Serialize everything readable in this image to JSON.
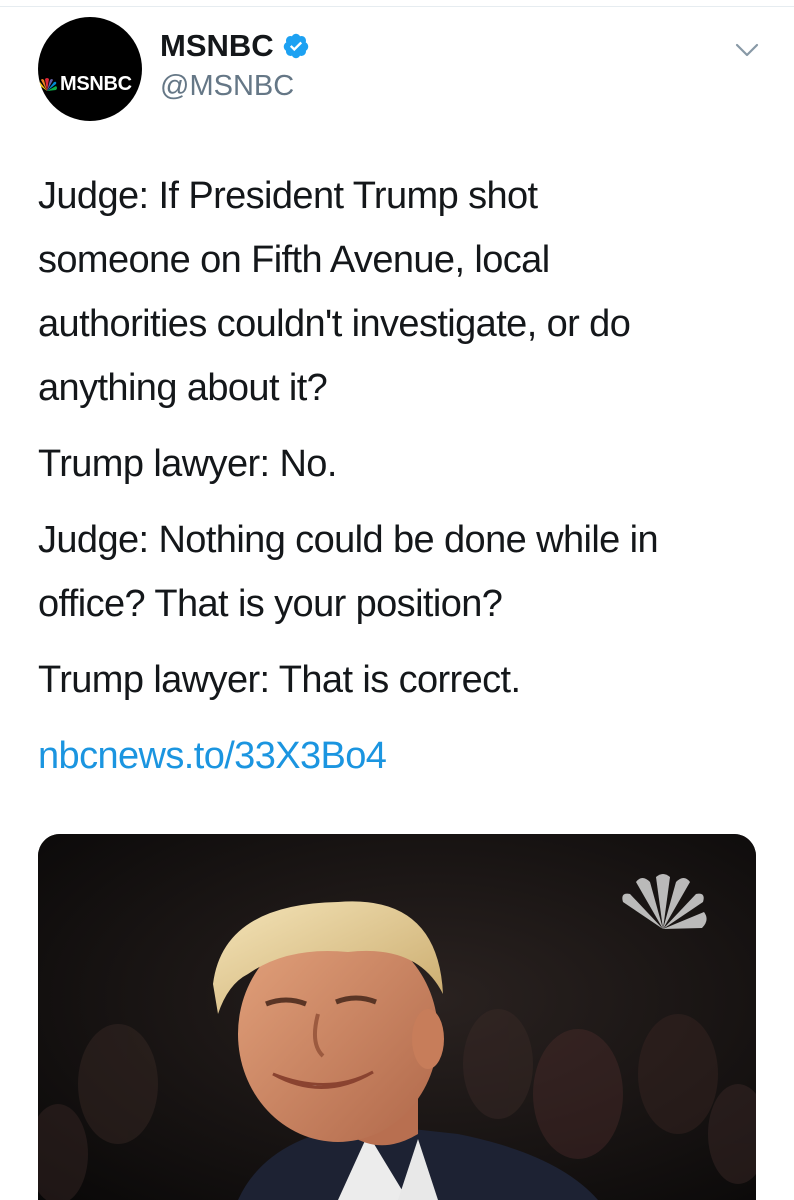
{
  "tweet": {
    "author": {
      "display_name": "MSNBC",
      "handle": "@MSNBC",
      "avatar_label": "MSNBC",
      "verified": true
    },
    "text_lines": [
      "Judge: If President Trump shot",
      "someone on Fifth Avenue, local",
      "authorities couldn't investigate, or do",
      "anything about it?",
      "Trump lawyer: No.",
      "Judge: Nothing could be done while in",
      "office? That is your position?",
      "Trump lawyer: That is correct."
    ],
    "link_text": "nbcnews.to/33X3Bo4",
    "media": {
      "description_icon": "nbc-peacock-watermark"
    }
  },
  "colors": {
    "link": "#1b95e0",
    "handle": "#657786",
    "verified": "#1da1f2",
    "text": "#14171a"
  }
}
